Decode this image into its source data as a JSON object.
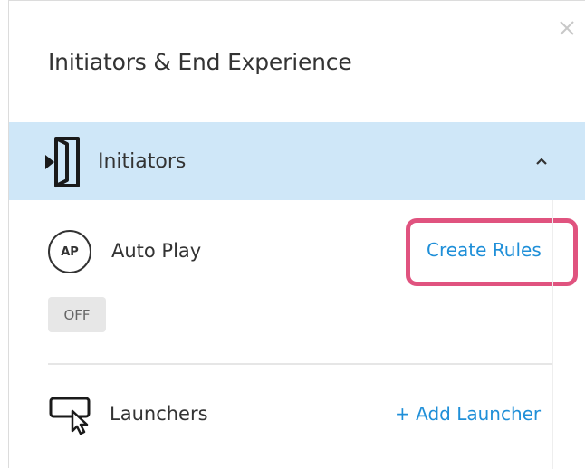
{
  "panel": {
    "title": "Initiators & End Experience",
    "close_icon": "close-icon"
  },
  "initiators": {
    "label": "Initiators",
    "icon": "door-enter-icon",
    "chevron_icon": "chevron-up-icon",
    "header_bg": "#cfe7f8"
  },
  "auto_play": {
    "badge": "AP",
    "label": "Auto Play",
    "create_rules": "Create Rules",
    "toggle": "OFF",
    "highlight_color": "#e0537f"
  },
  "launchers": {
    "icon": "cursor-click-icon",
    "label": "Launchers",
    "add_launcher": "+ Add Launcher"
  },
  "accent_link": "#1f8fd8"
}
